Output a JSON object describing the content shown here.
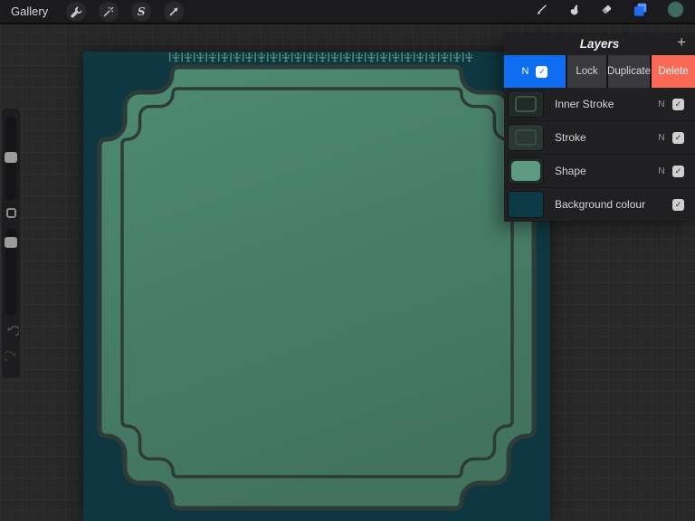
{
  "topbar": {
    "gallery_label": "Gallery",
    "left_tools": [
      "wrench",
      "adjustments",
      "selection",
      "transform"
    ],
    "selection_glyph": "S",
    "right_tools": [
      "brush",
      "smudge",
      "eraser",
      "layers",
      "color-swatch"
    ],
    "layers_active_color": "#1f6bf2",
    "color_swatch_color": "#3f6b5e"
  },
  "icons": {
    "plus": "+",
    "check": "✓"
  },
  "layers_panel": {
    "title": "Layers",
    "swipe_actions": {
      "blend_label": "N",
      "lock_label": "Lock",
      "duplicate_label": "Duplicate",
      "delete_label": "Delete",
      "blend_bg": "#0d6ef2",
      "delete_bg": "#f96955"
    },
    "layers": [
      {
        "name": "Inner Stroke",
        "blend": "N",
        "visible": true,
        "thumb_bg": "#202b27",
        "thumb_style": "outline",
        "thumb_color": "#5c8a76"
      },
      {
        "name": "Stroke",
        "blend": "N",
        "visible": true,
        "thumb_bg": "#293832",
        "thumb_style": "outline",
        "thumb_color": "#4a6357"
      },
      {
        "name": "Shape",
        "blend": "N",
        "visible": true,
        "thumb_bg": "#1f2b26",
        "thumb_style": "fill",
        "thumb_color": "#5d9b83"
      },
      {
        "name": "Background colour",
        "blend": "",
        "visible": true,
        "thumb_bg": "#0c3a44",
        "thumb_style": "none",
        "thumb_color": ""
      }
    ]
  },
  "canvas": {
    "background": "#0e3741",
    "shape_fill_light": "#4e8a73",
    "shape_fill_dark": "#41735f",
    "stroke_color": "#2e3c37",
    "ornament_color": "#4d8974"
  }
}
